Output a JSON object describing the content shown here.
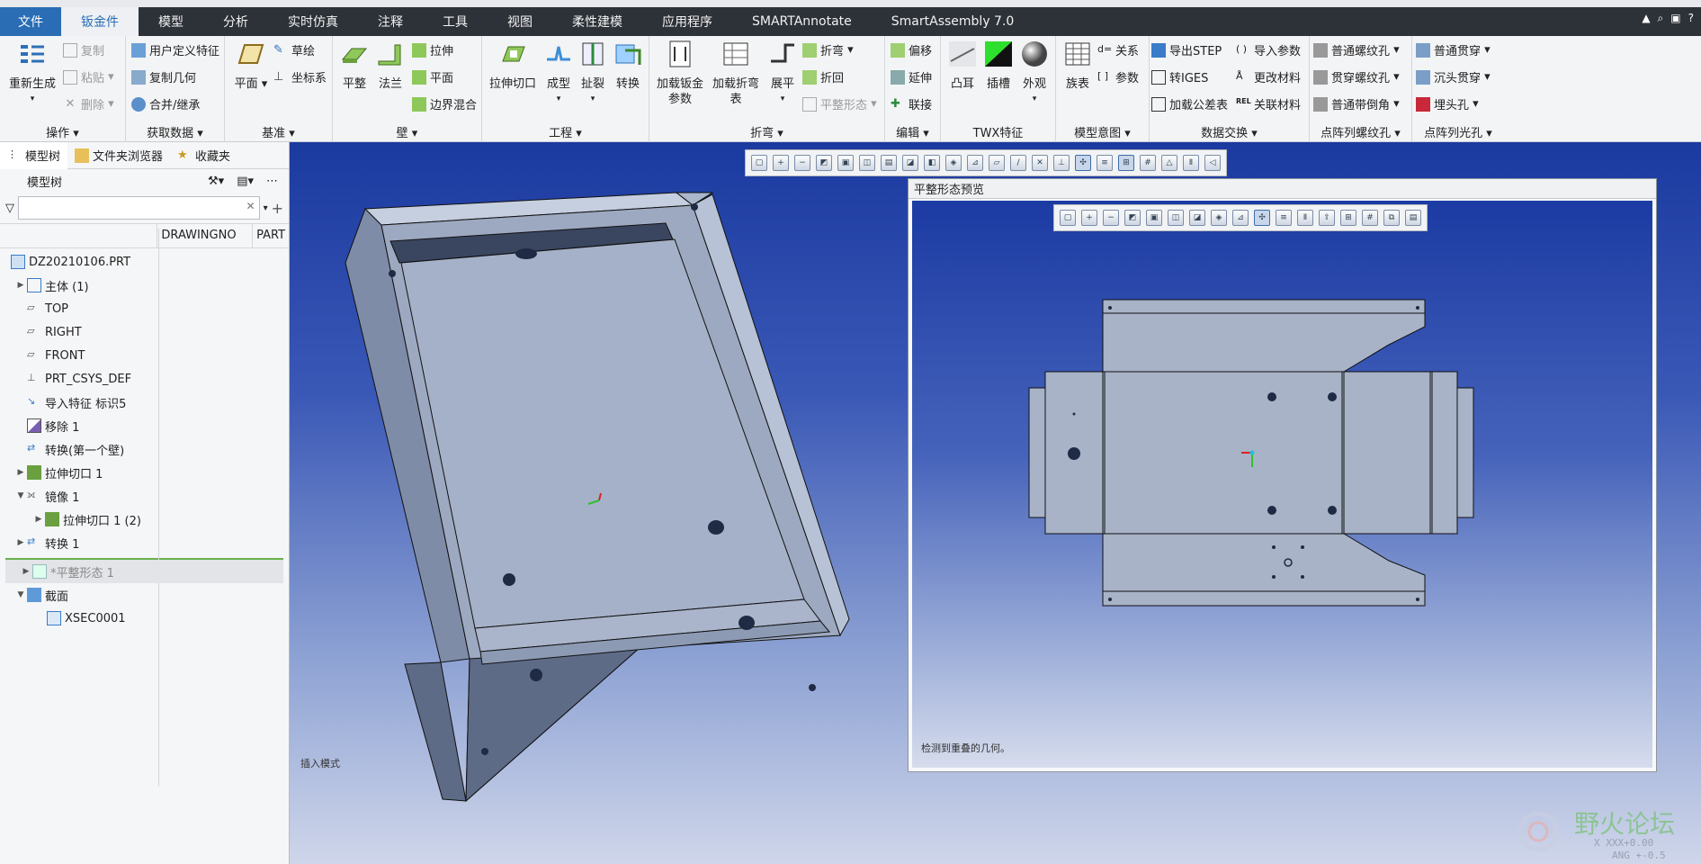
{
  "menubar": {
    "tabs": [
      "文件",
      "钣金件",
      "模型",
      "分析",
      "实时仿真",
      "注释",
      "工具",
      "视图",
      "柔性建模",
      "应用程序",
      "SMARTAnnotate",
      "SmartAssembly 7.0"
    ],
    "active": "钣金件"
  },
  "ribbon": {
    "op": {
      "label": "操作",
      "regen": "重新生成",
      "copy": "复制",
      "paste": "粘贴",
      "delete": "删除"
    },
    "getdata": {
      "label": "获取数据",
      "udf": "用户定义特征",
      "copygeom": "复制几何",
      "merge": "合并/继承"
    },
    "datum": {
      "label": "基准",
      "plane": "平面",
      "sketch": "草绘",
      "csys": "坐标系"
    },
    "wall": {
      "label": "壁",
      "flat": "平整",
      "flange": "法兰",
      "extrude": "拉伸",
      "planar": "平面",
      "blend": "边界混合"
    },
    "eng": {
      "label": "工程",
      "cut": "拉伸切口",
      "form": "成型",
      "rip": "扯裂",
      "convert": "转换"
    },
    "bend": {
      "label": "折弯",
      "load_params": "加载钣金\n参数",
      "load_table": "加载折弯\n表",
      "unbend": "展平",
      "bend": "折弯",
      "bendback": "折回",
      "flatform": "平整形态"
    },
    "edit": {
      "label": "编辑",
      "offset": "偏移",
      "extend": "延伸",
      "join": "联接"
    },
    "twx": {
      "label": "TWX特征",
      "boss": "凸耳",
      "slot": "插槽",
      "appearance": "外观"
    },
    "intent": {
      "label": "模型意图",
      "family": "族表",
      "relations": "关系",
      "params": "参数"
    },
    "exchange": {
      "label": "数据交换",
      "step": "导出STEP",
      "iges": "转IGES",
      "tol": "加载公差表",
      "import_params": "导入参数",
      "material": "更改材料",
      "rel_material": "关联材料"
    },
    "ptthread": {
      "label": "点阵列螺纹孔",
      "normal": "普通螺纹孔",
      "through": "贯穿螺纹孔",
      "chamfer": "普通带倒角"
    },
    "ptlight": {
      "label": "点阵列光孔",
      "normal": "普通贯穿",
      "counter": "沉头贯穿",
      "cbore": "埋头孔"
    }
  },
  "left": {
    "tabs": [
      "模型树",
      "文件夹浏览器",
      "收藏夹"
    ],
    "tree_title": "模型树",
    "columns": [
      "DRAWINGNO",
      "PART"
    ],
    "items": [
      {
        "label": "DZ20210106.PRT"
      },
      {
        "label": "主体 (1)"
      },
      {
        "label": "TOP"
      },
      {
        "label": "RIGHT"
      },
      {
        "label": "FRONT"
      },
      {
        "label": "PRT_CSYS_DEF"
      },
      {
        "label": "导入特征 标识5"
      },
      {
        "label": "移除 1"
      },
      {
        "label": "转换(第一个壁)"
      },
      {
        "label": "拉伸切口 1"
      },
      {
        "label": "镜像 1"
      },
      {
        "label": "拉伸切口 1 (2)"
      },
      {
        "label": "转换 1"
      },
      {
        "label": "*平整形态 1"
      },
      {
        "label": "截面"
      },
      {
        "label": "XSEC0001"
      }
    ]
  },
  "preview": {
    "title": "平整形态预览",
    "status": "检测到重叠的几何。"
  },
  "canvas": {
    "status": "插入模式"
  },
  "watermark": {
    "text": "野火论坛",
    "sub1": "X XXX+0.00",
    "sub2": "ANG +-0.5"
  }
}
